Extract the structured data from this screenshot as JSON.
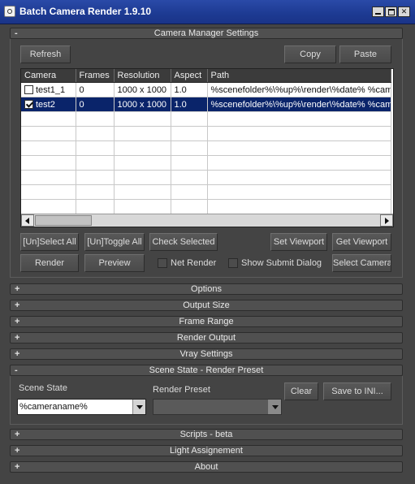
{
  "window": {
    "title": "Batch Camera Render 1.9.10"
  },
  "camera_manager": {
    "title": "Camera Manager Settings",
    "sign": "-",
    "refresh_label": "Refresh",
    "copy_label": "Copy",
    "paste_label": "Paste",
    "columns": [
      "Camera",
      "Frames",
      "Resolution",
      "Aspect",
      "Path"
    ],
    "rows": [
      {
        "camera": "test1_1",
        "frames": "0",
        "resolution": "1000 x 1000",
        "aspect": "1.0",
        "path": "%scenefolder%\\%up%\\render\\%date% %camera",
        "checked": false,
        "selected": false
      },
      {
        "camera": "test2",
        "frames": "0",
        "resolution": "1000 x 1000",
        "aspect": "1.0",
        "path": "%scenefolder%\\%up%\\render\\%date% %camera",
        "checked": true,
        "selected": true
      }
    ],
    "unselect_all_label": "[Un]Select All",
    "untoggle_all_label": "[Un]Toggle All",
    "check_selected_label": "Check Selected",
    "set_viewport_label": "Set Viewport",
    "get_viewport_label": "Get Viewport",
    "render_label": "Render",
    "preview_label": "Preview",
    "net_render_label": "Net Render",
    "show_submit_label": "Show Submit Dialog",
    "select_camera_label": "Select Camera"
  },
  "rollouts": {
    "plus": "+",
    "minus": "-",
    "options": "Options",
    "output_size": "Output Size",
    "frame_range": "Frame Range",
    "render_output": "Render Output",
    "vray_settings": "Vray Settings",
    "scene_state": "Scene State - Render Preset",
    "scripts": "Scripts - beta",
    "light_assignment": "Light Assignement",
    "about": "About"
  },
  "scene_state": {
    "scene_state_label": "Scene State",
    "scene_state_value": "%cameraname%",
    "render_preset_label": "Render Preset",
    "render_preset_value": "",
    "clear_label": "Clear",
    "save_ini_label": "Save to INI..."
  }
}
